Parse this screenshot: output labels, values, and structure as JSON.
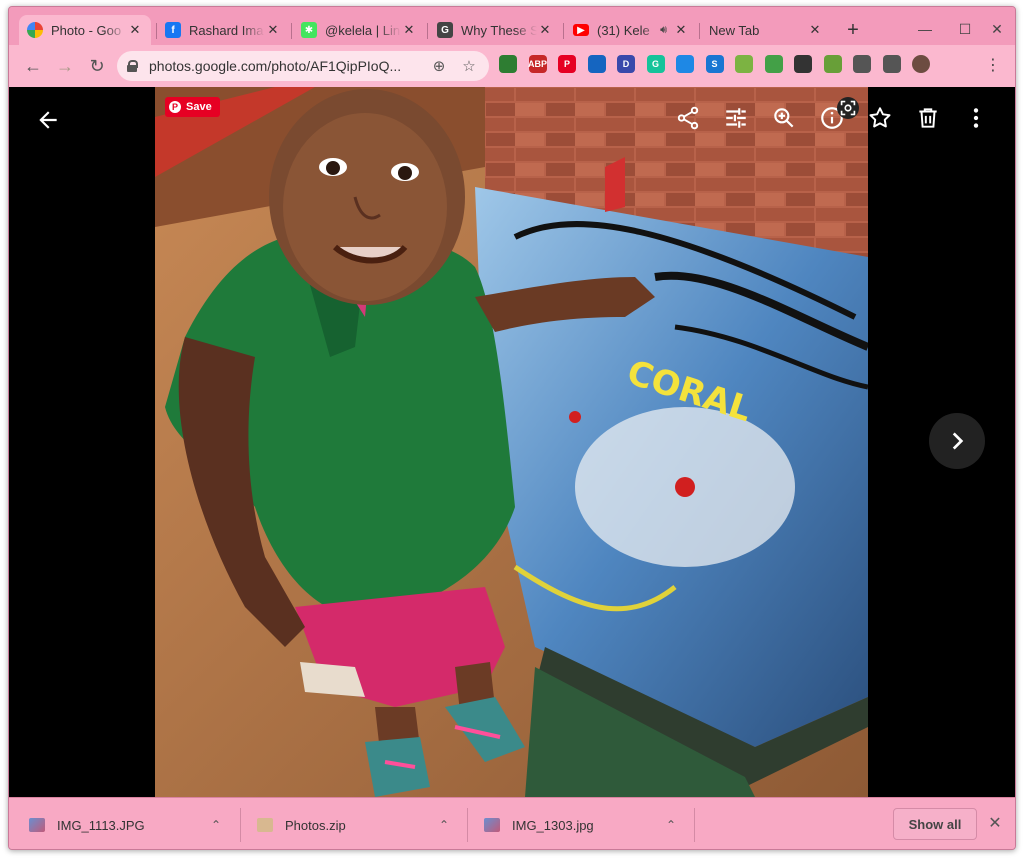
{
  "tabs": [
    {
      "title": "Photo - Goo",
      "favicon": "google-photos-icon",
      "color": "#ea4335",
      "active": true
    },
    {
      "title": "Rashard Ima",
      "favicon": "facebook-icon",
      "color": "#1877f2"
    },
    {
      "title": "@kelela | Lin",
      "favicon": "linktree-icon",
      "color": "#43e55e"
    },
    {
      "title": "Why These S",
      "favicon": "grammarly-icon",
      "color": "#444444"
    },
    {
      "title": "(31) Kele",
      "favicon": "youtube-icon",
      "color": "#ff0000",
      "audio": true
    },
    {
      "title": "New Tab",
      "favicon": "",
      "color": ""
    }
  ],
  "toolbar": {
    "url": "photos.google.com/photo/AF1QipPIoQ...",
    "extensions": [
      {
        "name": "extension-arrow-icon",
        "label": "",
        "color": "#2e7d32"
      },
      {
        "name": "adblock-plus-icon",
        "label": "ABP",
        "color": "#c62828"
      },
      {
        "name": "pinterest-icon",
        "label": "P",
        "color": "#e60023"
      },
      {
        "name": "reader-icon",
        "label": "",
        "color": "#1565c0"
      },
      {
        "name": "extension-d-icon",
        "label": "D",
        "color": "#3949ab"
      },
      {
        "name": "grammarly-ext-icon",
        "label": "G",
        "color": "#15c39a"
      },
      {
        "name": "bookmark-ext-icon",
        "label": "",
        "color": "#1e88e5"
      },
      {
        "name": "extension-s-icon",
        "label": "S",
        "color": "#1976d2"
      },
      {
        "name": "play-ext-icon",
        "label": "",
        "color": "#7cb342"
      },
      {
        "name": "print-ext-icon",
        "label": "",
        "color": "#43a047"
      },
      {
        "name": "download-ext-icon",
        "label": "",
        "color": "#333333"
      },
      {
        "name": "plant-ext-icon",
        "label": "",
        "color": "#689f38"
      },
      {
        "name": "extensions-puzzle-icon",
        "label": "",
        "color": "#555555"
      },
      {
        "name": "media-queue-icon",
        "label": "",
        "color": "#555555"
      },
      {
        "name": "profile-avatar-icon",
        "label": "",
        "color": "#6d4c41"
      }
    ]
  },
  "viewer": {
    "pin_save_label": "Save",
    "actions": [
      "share-icon",
      "edit-icon",
      "zoom-icon",
      "info-icon",
      "favorite-icon",
      "delete-icon",
      "more-options-icon"
    ]
  },
  "photo": {
    "text": "CORAL"
  },
  "downloads": [
    {
      "name": "IMG_1113.JPG",
      "type": "image"
    },
    {
      "name": "Photos.zip",
      "type": "archive"
    },
    {
      "name": "IMG_1303.jpg",
      "type": "image"
    }
  ],
  "shelf": {
    "show_all_label": "Show all"
  }
}
